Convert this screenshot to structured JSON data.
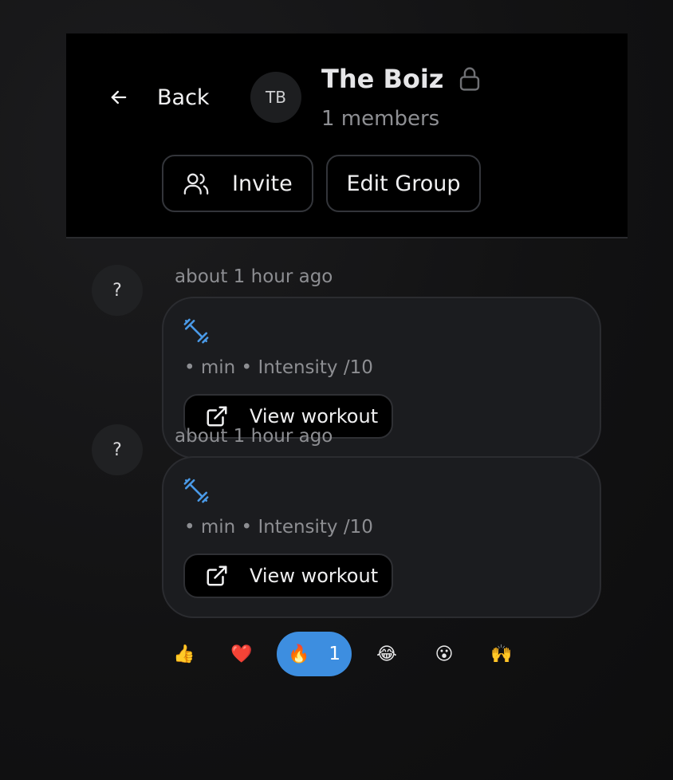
{
  "header": {
    "back_label": "Back",
    "avatar_initials": "TB",
    "group_name": "The Boiz",
    "members_text": "1 members",
    "invite_label": "Invite",
    "edit_label": "Edit Group"
  },
  "posts": [
    {
      "avatar": "?",
      "timestamp": "about 1 hour ago",
      "meta": "• min • Intensity /10",
      "view_label": "View workout"
    },
    {
      "avatar": "?",
      "timestamp": "about 1 hour ago",
      "meta": "• min • Intensity /10",
      "view_label": "View workout"
    }
  ],
  "reactions": [
    {
      "emoji": "👍",
      "name": "thumbs-up"
    },
    {
      "emoji": "❤️",
      "name": "heart"
    },
    {
      "emoji": "🔥",
      "name": "fire",
      "count": "1",
      "active": true
    },
    {
      "emoji": "😂",
      "name": "laughing"
    },
    {
      "emoji": "😮",
      "name": "surprised"
    },
    {
      "emoji": "🙌",
      "name": "raised-hands"
    }
  ],
  "colors": {
    "accent": "#3d8ee0",
    "icon_blue": "#4a9ae8",
    "card_bg": "#1b1c1f",
    "header_bg": "#000000"
  }
}
